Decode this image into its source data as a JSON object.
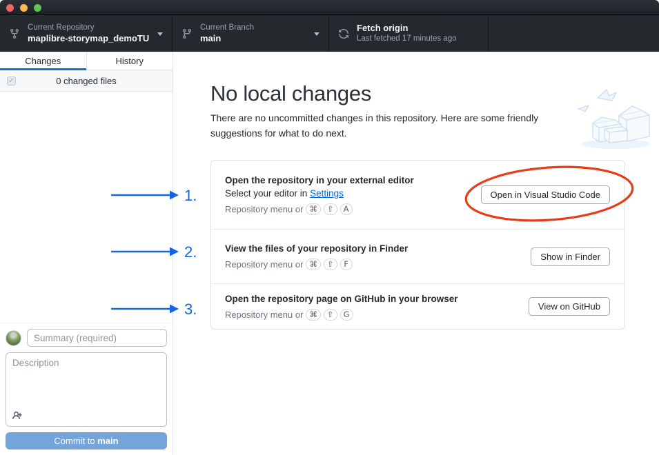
{
  "titlebar": {
    "buttons": [
      "close",
      "minimize",
      "zoom"
    ]
  },
  "toolbar": {
    "repository": {
      "label": "Current Repository",
      "value": "maplibre-storymap_demoTU",
      "icon": "repo-forked-icon"
    },
    "branch": {
      "label": "Current Branch",
      "value": "main",
      "icon": "git-branch-icon"
    },
    "fetch": {
      "label": "Fetch origin",
      "sublabel": "Last fetched 17 minutes ago",
      "icon": "sync-icon"
    }
  },
  "sidebar": {
    "tabs": [
      {
        "label": "Changes",
        "active": true
      },
      {
        "label": "History",
        "active": false
      }
    ],
    "changed_files": {
      "label": "0 changed files",
      "checkbox_checked": true,
      "checkmark": "✓"
    },
    "commit": {
      "summary_placeholder": "Summary (required)",
      "description_placeholder": "Description",
      "coauthor_icon": "person-add-icon",
      "button_prefix": "Commit to ",
      "button_branch": "main"
    }
  },
  "main": {
    "title": "No local changes",
    "subtitle": "There are no uncommitted changes in this repository. Here are some friendly suggestions for what to do next.",
    "suggestions": [
      {
        "title": "Open the repository in your external editor",
        "line2_prefix": "Select your editor in ",
        "line2_link": "Settings",
        "shortcut_prefix": "Repository menu or",
        "keys": [
          "⌘",
          "⇧",
          "A"
        ],
        "button": "Open in Visual Studio Code"
      },
      {
        "title": "View the files of your repository in Finder",
        "shortcut_prefix": "Repository menu or",
        "keys": [
          "⌘",
          "⇧",
          "F"
        ],
        "button": "Show in Finder"
      },
      {
        "title": "Open the repository page on GitHub in your browser",
        "shortcut_prefix": "Repository menu or",
        "keys": [
          "⌘",
          "⇧",
          "G"
        ],
        "button": "View on GitHub"
      }
    ]
  },
  "annotations": {
    "numbers": [
      "1.",
      "2.",
      "3."
    ],
    "arrow_color": "#1565e0",
    "circle_color": "#e63c18"
  },
  "colors": {
    "toolbar_bg": "#24292e",
    "accent_blue": "#0f6fd7",
    "link_blue": "#0366d6",
    "commit_button_blue": "#74a4da",
    "annotation_blue": "#1565e0",
    "annotation_red": "#e63c18"
  }
}
